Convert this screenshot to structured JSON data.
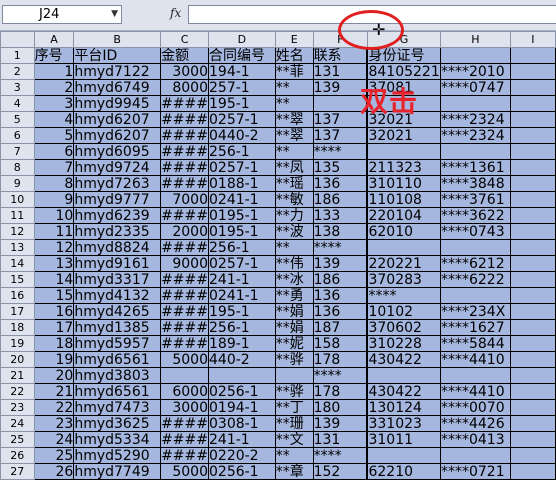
{
  "formula_bar": {
    "cell_ref": "J24",
    "dropdown_glyph": "▼",
    "fx_label": "fx",
    "formula": ""
  },
  "annotation": {
    "text": "双击",
    "color": "#e8232b"
  },
  "columns": [
    "A",
    "B",
    "C",
    "D",
    "E",
    "F",
    "G",
    "H",
    "I"
  ],
  "rows": [
    {
      "n": "1",
      "a": "序号",
      "b": "平台ID",
      "c": "金额",
      "d": "合同编号",
      "e": "姓名",
      "f": "联系",
      "g": "身份证号",
      "h": "",
      "": ""
    },
    {
      "n": "2",
      "a": "1",
      "b": "hmyd7122",
      "c": "3000",
      "d": "194-1",
      "e": "**菲",
      "f": "131",
      "g": "84105221",
      "h": "****2010"
    },
    {
      "n": "3",
      "a": "2",
      "b": "hmyd6749",
      "c": "8000",
      "d": "257-1",
      "e": "**",
      "f": "139",
      "g": "37081",
      "h": "****0747"
    },
    {
      "n": "4",
      "a": "3",
      "b": "hmyd9945",
      "c": "####",
      "d": "195-1",
      "e": "**",
      "f": "",
      "g": "",
      "h": ""
    },
    {
      "n": "5",
      "a": "4",
      "b": "hmyd6207",
      "c": "####",
      "d": "0257-1",
      "e": "**翠",
      "f": "137",
      "g": "32021",
      "h": "****2324"
    },
    {
      "n": "6",
      "a": "5",
      "b": "hmyd6207",
      "c": "####",
      "d": "0440-2",
      "e": "**翠",
      "f": "137",
      "g": "32021",
      "h": "****2324"
    },
    {
      "n": "7",
      "a": "6",
      "b": "hmyd6095",
      "c": "####",
      "d": "256-1",
      "e": "**",
      "f": "****",
      "g": "",
      "h": ""
    },
    {
      "n": "8",
      "a": "7",
      "b": "hmyd9724",
      "c": "####",
      "d": "0257-1",
      "e": "**凤",
      "f": "135",
      "g": "211323",
      "h": "****1361"
    },
    {
      "n": "9",
      "a": "8",
      "b": "hmyd7263",
      "c": "####",
      "d": "0188-1",
      "e": "**瑶",
      "f": "136",
      "g": "310110",
      "h": "****3848"
    },
    {
      "n": "10",
      "a": "9",
      "b": "hmyd9777",
      "c": "7000",
      "d": "0241-1",
      "e": "**敏",
      "f": "186",
      "g": "110108",
      "h": "****3761"
    },
    {
      "n": "11",
      "a": "10",
      "b": "hmyd6239",
      "c": "####",
      "d": "0195-1",
      "e": "**力",
      "f": "133",
      "g": "220104",
      "h": "****3622"
    },
    {
      "n": "12",
      "a": "11",
      "b": "hmyd2335",
      "c": "2000",
      "d": "0195-1",
      "e": "**波",
      "f": "138",
      "g": "62010",
      "h": "****0743"
    },
    {
      "n": "13",
      "a": "12",
      "b": "hmyd8824",
      "c": "####",
      "d": "256-1",
      "e": "**",
      "f": "****",
      "g": "",
      "h": ""
    },
    {
      "n": "14",
      "a": "13",
      "b": "hmyd9161",
      "c": "9000",
      "d": "0257-1",
      "e": "**伟",
      "f": "139",
      "g": "220221",
      "h": "****6212"
    },
    {
      "n": "15",
      "a": "14",
      "b": "hmyd3317",
      "c": "####",
      "d": "241-1",
      "e": "**冰",
      "f": "186",
      "g": "370283",
      "h": "****6222"
    },
    {
      "n": "16",
      "a": "15",
      "b": "hmyd4132",
      "c": "####",
      "d": "0241-1",
      "e": "**勇",
      "f": "136",
      "g": "****",
      "h": ""
    },
    {
      "n": "17",
      "a": "16",
      "b": "hmyd4265",
      "c": "####",
      "d": "195-1",
      "e": "**娟",
      "f": "136",
      "g": "10102",
      "h": "****234X"
    },
    {
      "n": "18",
      "a": "17",
      "b": "hmyd1385",
      "c": "####",
      "d": "256-1",
      "e": "**娟",
      "f": "187",
      "g": "370602",
      "h": "****1627"
    },
    {
      "n": "19",
      "a": "18",
      "b": "hmyd5957",
      "c": "####",
      "d": "189-1",
      "e": "**妮",
      "f": "158",
      "g": "310228",
      "h": "****5844"
    },
    {
      "n": "20",
      "a": "19",
      "b": "hmyd6561",
      "c": "5000",
      "d": "440-2",
      "e": "**骅",
      "f": "178",
      "g": "430422",
      "h": "****4410"
    },
    {
      "n": "21",
      "a": "20",
      "b": "hmyd3803",
      "c": "",
      "d": "",
      "e": "",
      "f": "****",
      "g": "",
      "h": ""
    },
    {
      "n": "22",
      "a": "21",
      "b": "hmyd6561",
      "c": "6000",
      "d": "0256-1",
      "e": "**骅",
      "f": "178",
      "g": "430422",
      "h": "****4410"
    },
    {
      "n": "23",
      "a": "22",
      "b": "hmyd7473",
      "c": "3000",
      "d": "0194-1",
      "e": "**丁",
      "f": "180",
      "g": "130124",
      "h": "****0070"
    },
    {
      "n": "24",
      "a": "23",
      "b": "hmyd3625",
      "c": "####",
      "d": "0308-1",
      "e": "**珊",
      "f": "139",
      "g": "331023",
      "h": "****4426"
    },
    {
      "n": "25",
      "a": "24",
      "b": "hmyd5334",
      "c": "####",
      "d": "241-1",
      "e": "**文",
      "f": "131",
      "g": "31011",
      "h": "****0413"
    },
    {
      "n": "26",
      "a": "25",
      "b": "hmyd5290",
      "c": "####",
      "d": "0220-2",
      "e": "**",
      "f": "****",
      "g": "",
      "h": ""
    },
    {
      "n": "27",
      "a": "26",
      "b": "hmyd7749",
      "c": "5000",
      "d": "0256-1",
      "e": "**章",
      "f": "152",
      "g": "62210",
      "h": "****0721"
    }
  ]
}
